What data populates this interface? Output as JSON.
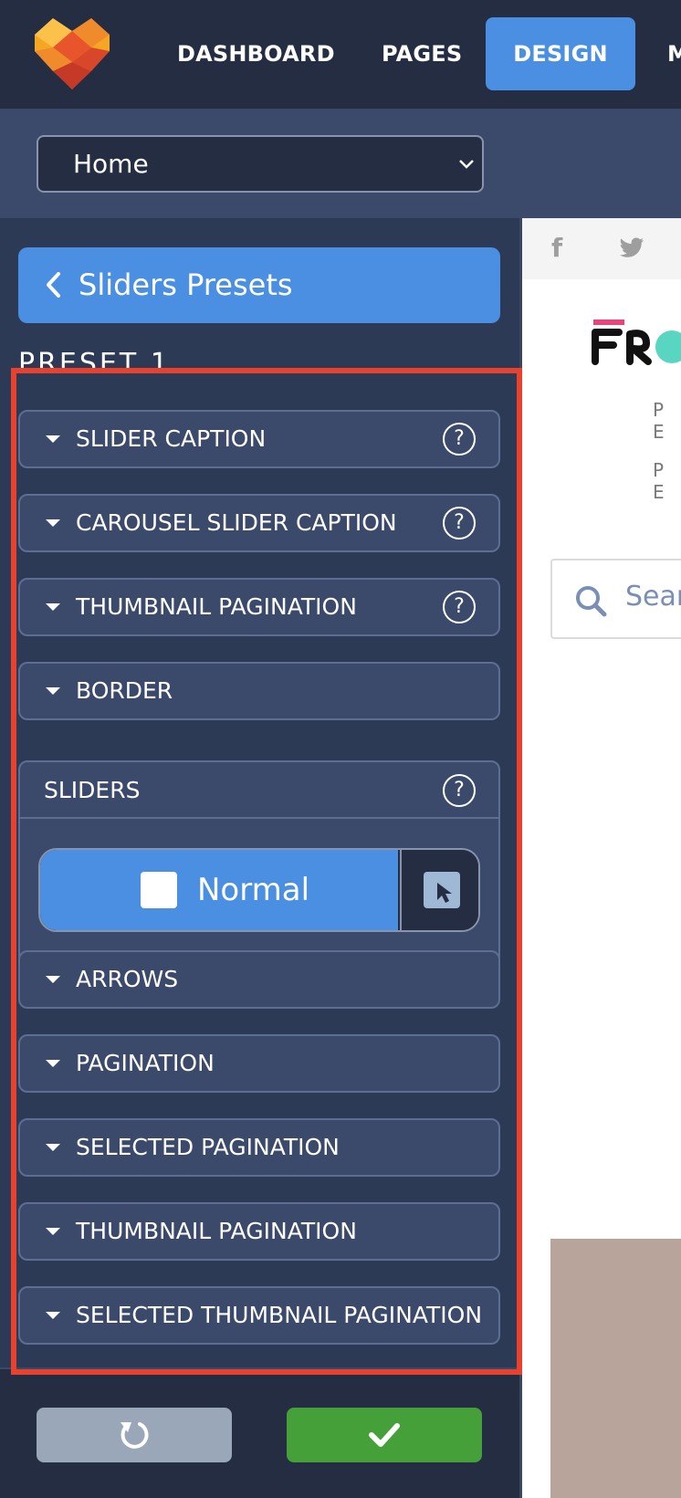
{
  "topnav": {
    "items": [
      {
        "label": "DASHBOARD"
      },
      {
        "label": "PAGES"
      },
      {
        "label": "DESIGN",
        "active": true
      },
      {
        "label": "M"
      }
    ]
  },
  "page_select": {
    "value": "Home"
  },
  "panel": {
    "back_label": "Sliders Presets",
    "preset_title": "PRESET 1",
    "sections": [
      {
        "label": "SLIDER CAPTION",
        "help": "?"
      },
      {
        "label": "CAROUSEL SLIDER CAPTION",
        "help": "?"
      },
      {
        "label": "THUMBNAIL PAGINATION",
        "help": "?"
      },
      {
        "label": "BORDER"
      },
      {
        "label": "ARROWS"
      },
      {
        "label": "PAGINATION"
      },
      {
        "label": "SELECTED PAGINATION"
      },
      {
        "label": "THUMBNAIL PAGINATION"
      },
      {
        "label": "SELECTED THUMBNAIL PAGINATION"
      }
    ],
    "sliders": {
      "label": "SLIDERS",
      "help": "?",
      "state_normal": "Normal"
    }
  },
  "preview": {
    "pe_line_1": "P E",
    "pe_line_2": "P E",
    "search_placeholder": "Sear"
  },
  "colors": {
    "accent": "#4a8fe2",
    "save": "#46a03a",
    "highlight_frame": "#e8412d"
  }
}
